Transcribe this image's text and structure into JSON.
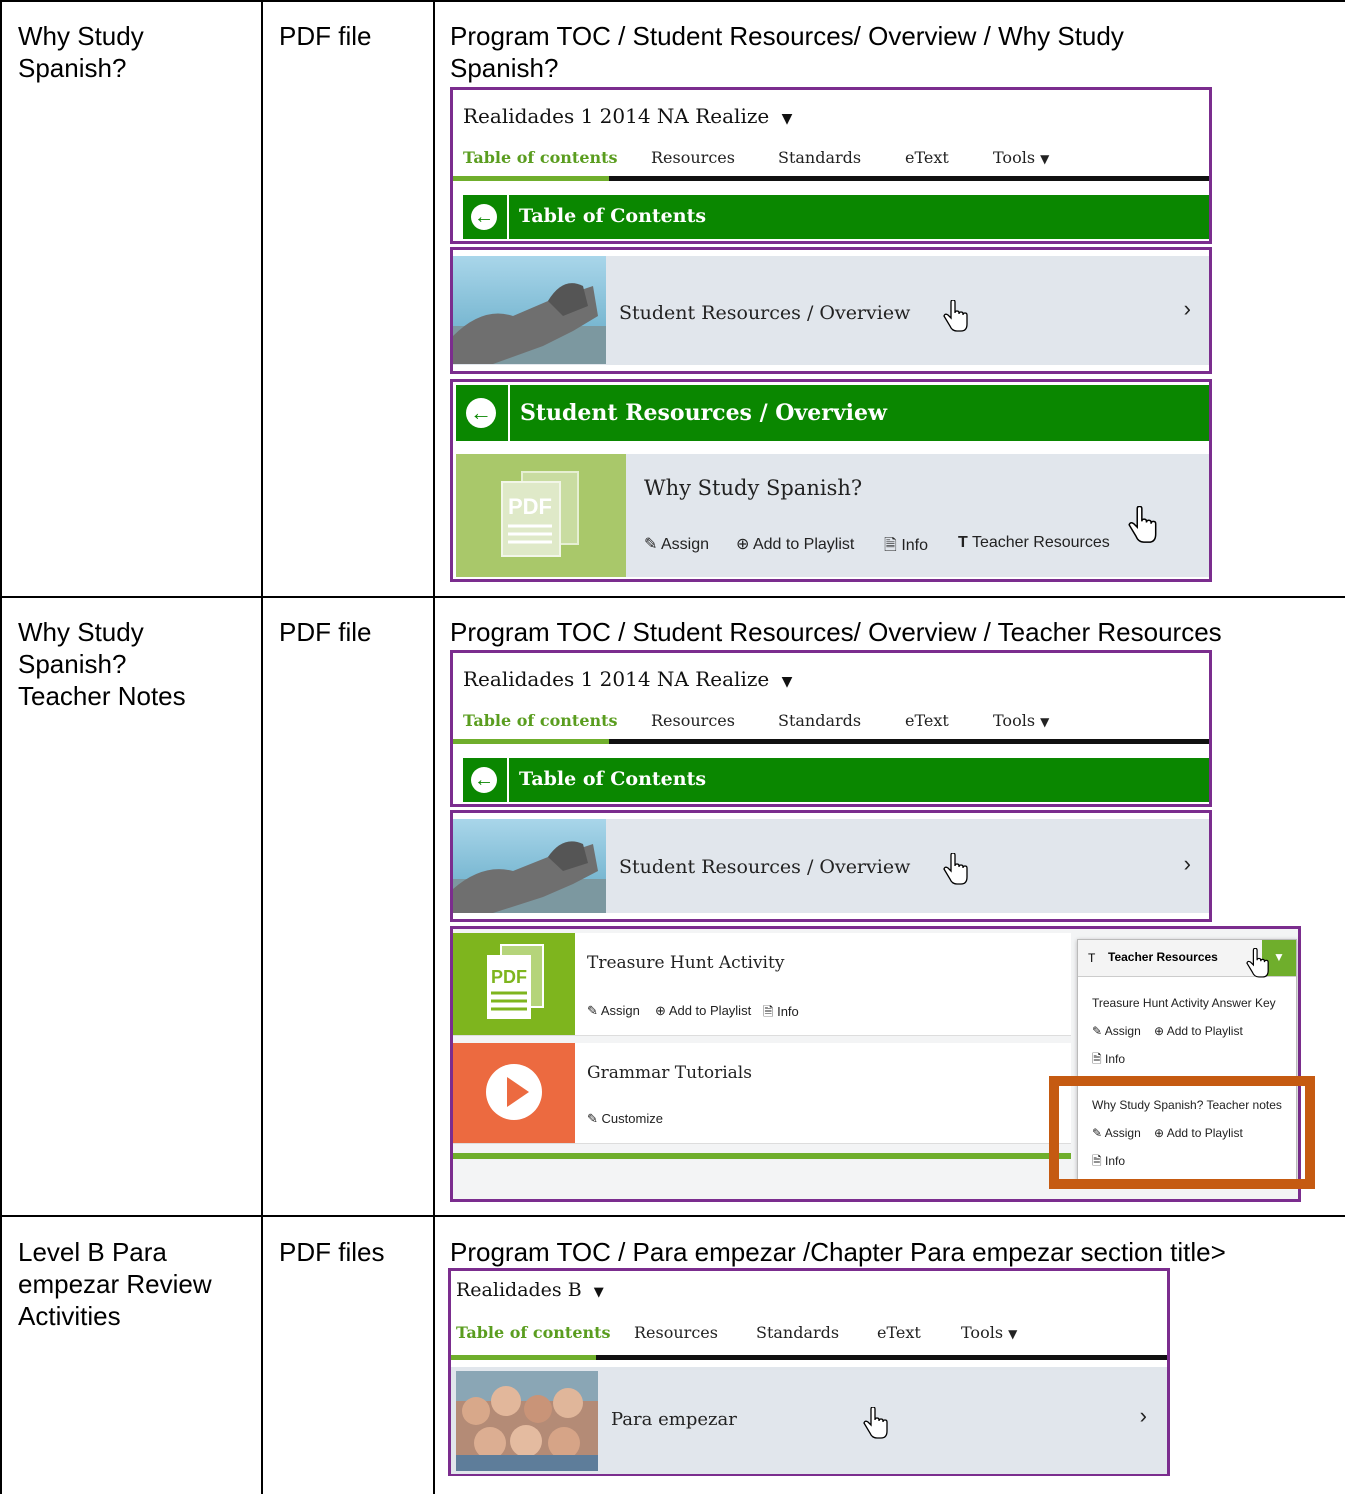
{
  "rows": [
    {
      "name_lines": [
        "Why Study",
        "Spanish?"
      ],
      "type": "PDF file",
      "path_lines": [
        "Program TOC / Student Resources/ Overview / Why Study",
        "Spanish?"
      ]
    },
    {
      "name_lines": [
        "Why Study",
        "Spanish?",
        "Teacher Notes"
      ],
      "type": "PDF file",
      "path_lines": [
        "Program TOC / Student Resources/ Overview / Teacher Resources"
      ]
    },
    {
      "name_lines": [
        "Level B Para",
        "empezar Review",
        "Activities"
      ],
      "type": "PDF files",
      "path_lines": [
        "Program TOC / Para empezar /Chapter Para empezar section title>"
      ]
    }
  ],
  "shot1": {
    "program": "Realidades 1 2014 NA Realize",
    "tabs": [
      "Table of contents",
      "Resources",
      "Standards",
      "eText",
      "Tools"
    ],
    "toc_bar": "Table of Contents",
    "item": "Student Resources / Overview",
    "section_bar": "Student Resources / Overview",
    "resource_title": "Why Study Spanish?",
    "pdf_label": "PDF",
    "actions": [
      "Assign",
      "Add to Playlist",
      "Info",
      "Teacher Resources"
    ]
  },
  "shot2": {
    "program": "Realidades 1 2014 NA Realize",
    "tabs": [
      "Table of contents",
      "Resources",
      "Standards",
      "eText",
      "Tools"
    ],
    "toc_bar": "Table of Contents",
    "item": "Student Resources / Overview",
    "pdf_label": "PDF",
    "resource1": "Treasure Hunt Activity",
    "resource1_actions": [
      "Assign",
      "Add to Playlist",
      "Info"
    ],
    "resource2": "Grammar Tutorials",
    "resource2_action": "Customize",
    "dropdown": {
      "header": "Teacher Resources",
      "header_icon": "T",
      "item1": "Treasure Hunt Activity Answer Key",
      "item2": "Why Study Spanish? Teacher notes",
      "actions": [
        "Assign",
        "Add to Playlist",
        "Info"
      ]
    }
  },
  "shot3": {
    "program": "Realidades B",
    "tabs": [
      "Table of contents",
      "Resources",
      "Standards",
      "eText",
      "Tools"
    ],
    "item": "Para empezar"
  },
  "colors": {
    "frame_purple": "#7b2d8e",
    "green_bar": "#0a8700",
    "tab_active": "#5a9d1f",
    "row_bg": "#e1e6ec",
    "pdf_green": "#a9c86a",
    "video_orange": "#ec6a40",
    "highlight_orange": "#c55a11"
  }
}
